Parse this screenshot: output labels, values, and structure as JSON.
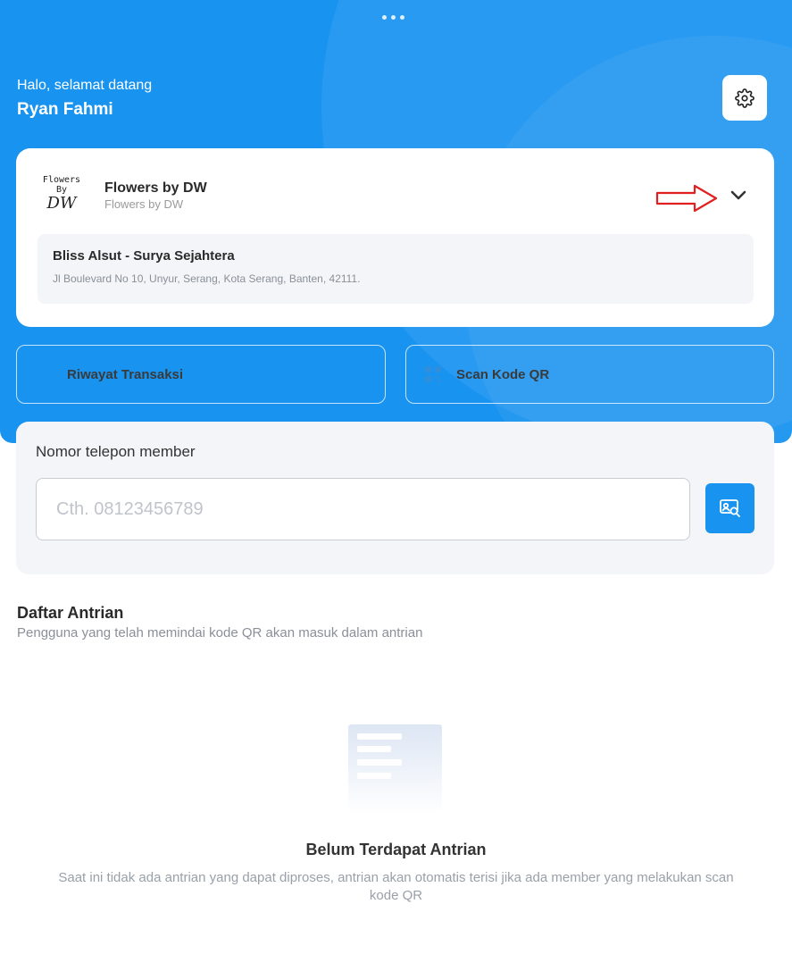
{
  "header": {
    "greeting": "Halo, selamat datang",
    "user_name": "Ryan Fahmi"
  },
  "icons": {
    "settings": "gear-icon",
    "dropdown": "chevron-down-icon",
    "annotation": "red-arrow-right-icon",
    "scan": "qr-code-icon",
    "search": "search-id-card-icon",
    "empty": "empty-list-icon"
  },
  "store": {
    "logo_text_line1": "Flowers",
    "logo_text_line2": "By",
    "logo_text_line3": "DW",
    "name": "Flowers by DW",
    "subtitle": "Flowers by DW",
    "branch": {
      "name": "Bliss Alsut - Surya Sejahtera",
      "address": "Jl Boulevard No 10, Unyur, Serang, Kota Serang, Banten, 42111."
    }
  },
  "actions": {
    "history_label": "Riwayat Transaksi",
    "scan_label": "Scan Kode QR"
  },
  "member_search": {
    "label": "Nomor telepon member",
    "placeholder": "Cth. 08123456789",
    "value": ""
  },
  "queue": {
    "title": "Daftar Antrian",
    "subtitle": "Pengguna yang telah memindai kode QR akan masuk dalam antrian",
    "empty_title": "Belum Terdapat Antrian",
    "empty_description": "Saat ini tidak ada antrian yang dapat diproses, antrian akan otomatis terisi jika ada member yang melakukan scan kode QR"
  },
  "colors": {
    "primary": "#1893f0",
    "annotation_red": "#e02020",
    "panel_bg": "#f3f5f8"
  }
}
